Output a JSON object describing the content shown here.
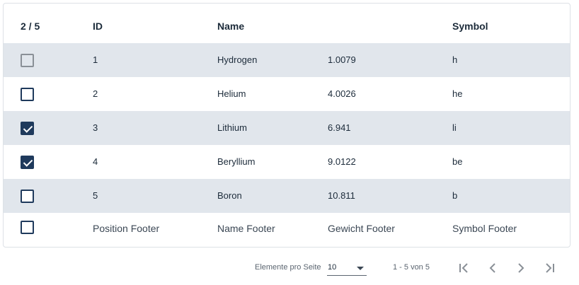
{
  "table": {
    "header": {
      "selection_count": "2 / 5",
      "id": "ID",
      "name": "Name",
      "weight": "",
      "symbol": "Symbol"
    },
    "rows": [
      {
        "id": "1",
        "name": "Hydrogen",
        "weight": "1.0079",
        "symbol": "h",
        "checked": false,
        "disabled": true
      },
      {
        "id": "2",
        "name": "Helium",
        "weight": "4.0026",
        "symbol": "he",
        "checked": false,
        "disabled": false
      },
      {
        "id": "3",
        "name": "Lithium",
        "weight": "6.941",
        "symbol": "li",
        "checked": true,
        "disabled": false
      },
      {
        "id": "4",
        "name": "Beryllium",
        "weight": "9.0122",
        "symbol": "be",
        "checked": true,
        "disabled": false
      },
      {
        "id": "5",
        "name": "Boron",
        "weight": "10.811",
        "symbol": "b",
        "checked": false,
        "disabled": false
      }
    ],
    "footer": {
      "position": "Position Footer",
      "name": "Name Footer",
      "weight": "Gewicht Footer",
      "symbol": "Symbol Footer"
    }
  },
  "paginator": {
    "items_per_page_label": "Elemente pro Seite",
    "items_per_page_value": "10",
    "range_label": "1 - 5 von 5",
    "icons": [
      "first-page-icon",
      "previous-page-icon",
      "next-page-icon",
      "last-page-icon"
    ]
  },
  "colors": {
    "accent": "#1f3a5c",
    "row_shade": "#e1e6ec",
    "disabled_icon": "#8a9097"
  }
}
